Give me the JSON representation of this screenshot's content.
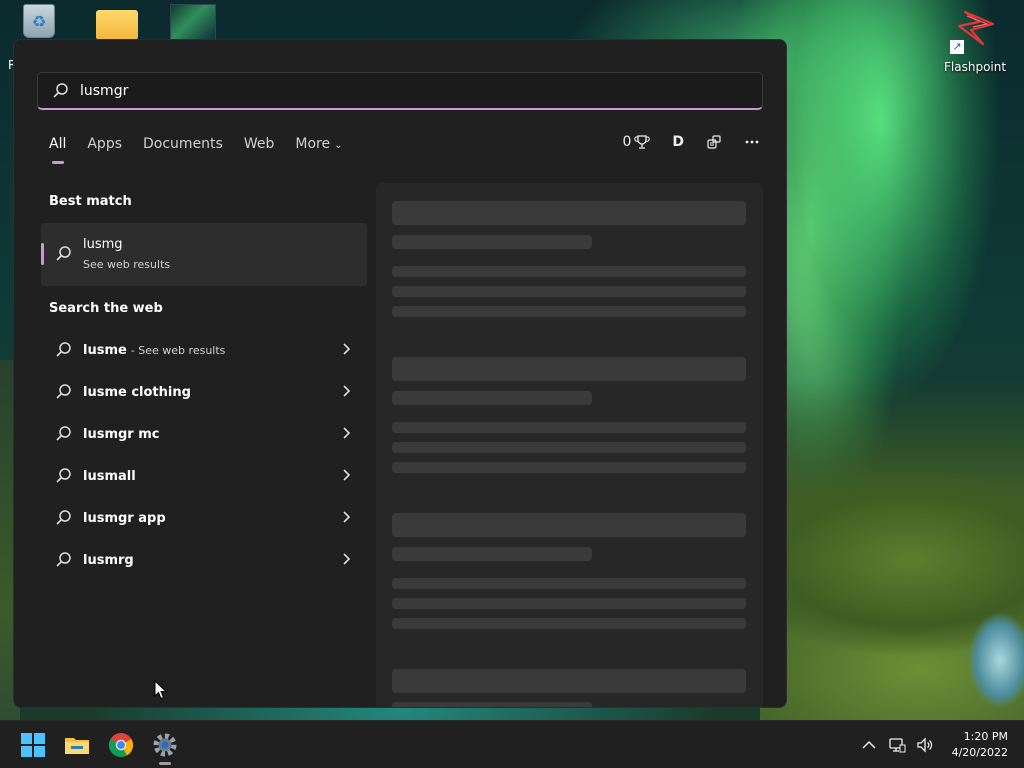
{
  "desktop": {
    "left_label": "R",
    "flashpoint_label": "Flashpoint"
  },
  "search": {
    "query": "lusmgr",
    "tabs": [
      {
        "label": "All",
        "active": true
      },
      {
        "label": "Apps"
      },
      {
        "label": "Documents"
      },
      {
        "label": "Web"
      },
      {
        "label": "More"
      }
    ],
    "points": "0",
    "avatar": "D",
    "best_match_title": "Best match",
    "best_match": {
      "title": "lusmg",
      "subtitle": "See web results"
    },
    "web_title": "Search the web",
    "web_items": [
      {
        "label": "lusme",
        "suffix": "- See web results"
      },
      {
        "label": "lusme clothing",
        "suffix": ""
      },
      {
        "label": "lusmgr mc",
        "suffix": ""
      },
      {
        "label": "lusmall",
        "suffix": ""
      },
      {
        "label": "lusmgr app",
        "suffix": ""
      },
      {
        "label": "lusmrg",
        "suffix": ""
      }
    ]
  },
  "taskbar": {
    "time": "1:20 PM",
    "date": "4/20/2022"
  },
  "colors": {
    "accent": "#c99ad1",
    "panel": "#202020",
    "taskbar": "#202020"
  }
}
